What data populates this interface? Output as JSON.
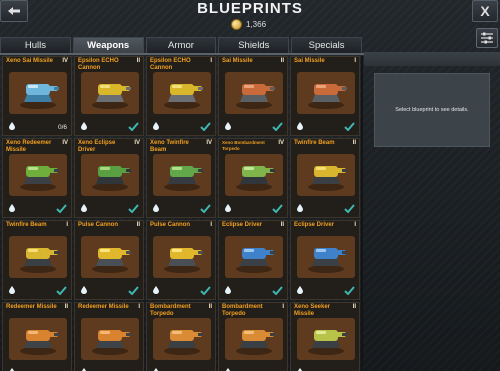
{
  "header": {
    "title": "BLUEPRINTS",
    "credits": "1,366",
    "close_label": "X"
  },
  "tabs": [
    {
      "label": "Hulls",
      "active": false
    },
    {
      "label": "Weapons",
      "active": true
    },
    {
      "label": "Armor",
      "active": false
    },
    {
      "label": "Shields",
      "active": false
    },
    {
      "label": "Specials",
      "active": false
    }
  ],
  "detail_panel": {
    "message": "Select blueprint to see details."
  },
  "colors": {
    "name_orange": "#f0a020",
    "check_teal": "#3fb6b0",
    "card_bg": "#5e3b1f"
  },
  "blueprints": [
    {
      "name": "Xeno Sai Missile",
      "tier": "IV",
      "icon": "xeno-launcher-icon",
      "count": "0/6",
      "status": "count"
    },
    {
      "name": "Epsilon ECHO Cannon",
      "tier": "II",
      "icon": "yellow-cannon-icon",
      "status": "owned"
    },
    {
      "name": "Epsilon ECHO Cannon",
      "tier": "I",
      "icon": "yellow-cannon-icon",
      "status": "owned"
    },
    {
      "name": "Sai Missile",
      "tier": "II",
      "icon": "sai-missile-icon",
      "status": "owned"
    },
    {
      "name": "Sai Missile",
      "tier": "I",
      "icon": "sai-missile-icon",
      "status": "owned"
    },
    {
      "name": "Xeno Redeemer Missile",
      "tier": "IV",
      "icon": "green-launcher-icon",
      "status": "owned"
    },
    {
      "name": "Xeno Eclipse Driver",
      "tier": "IV",
      "icon": "green-driver-icon",
      "status": "owned"
    },
    {
      "name": "Xeno Twinfire Beam",
      "tier": "IV",
      "icon": "green-beam-icon",
      "status": "owned"
    },
    {
      "name": "Xeno Bombardment Torpedo",
      "tier": "IV",
      "icon": "green-torpedo-icon",
      "status": "owned",
      "small": true
    },
    {
      "name": "Twinfire Beam",
      "tier": "II",
      "icon": "yellow-beam-icon",
      "status": "owned"
    },
    {
      "name": "Twinfire Beam",
      "tier": "I",
      "icon": "yellow-beam-icon",
      "status": "owned"
    },
    {
      "name": "Pulse Cannon",
      "tier": "II",
      "icon": "pulse-cannon-icon",
      "status": "owned"
    },
    {
      "name": "Pulse Cannon",
      "tier": "I",
      "icon": "pulse-cannon-icon",
      "status": "owned"
    },
    {
      "name": "Eclipse Driver",
      "tier": "II",
      "icon": "blue-driver-icon",
      "status": "owned"
    },
    {
      "name": "Eclipse Driver",
      "tier": "I",
      "icon": "blue-driver-icon",
      "status": "owned"
    },
    {
      "name": "Redeemer Missile",
      "tier": "II",
      "icon": "redeemer-missile-icon",
      "status": "none"
    },
    {
      "name": "Redeemer Missile",
      "tier": "I",
      "icon": "redeemer-missile-icon",
      "status": "none"
    },
    {
      "name": "Bombardment Torpedo",
      "tier": "II",
      "icon": "torpedo-icon",
      "status": "none"
    },
    {
      "name": "Bombardment Torpedo",
      "tier": "I",
      "icon": "torpedo-icon",
      "status": "none"
    },
    {
      "name": "Xeno Seeker Missile",
      "tier": "II",
      "icon": "seeker-missile-icon",
      "status": "none"
    }
  ]
}
